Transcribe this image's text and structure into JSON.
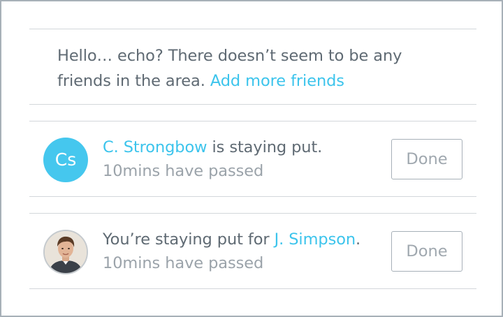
{
  "notice": {
    "text": "Hello… echo? There doesn’t seem to be any friends in the area.",
    "link": "Add more friends"
  },
  "notifications": [
    {
      "avatar_initials": "Cs",
      "name": "C. Strongbow",
      "message": " is staying put.",
      "time": "10mins have passed",
      "button": "Done"
    },
    {
      "avatar_type": "photo",
      "prefix": "You’re staying put for ",
      "name": "J. Simpson",
      "suffix": ".",
      "time": "10mins have passed",
      "button": "Done"
    }
  ],
  "colors": {
    "link": "#3cc4ec",
    "avatar": "#45c7ee",
    "text": "#5f6a73",
    "muted": "#9ba3aa",
    "divider": "#d3d7db",
    "border": "#a7b0b8"
  }
}
